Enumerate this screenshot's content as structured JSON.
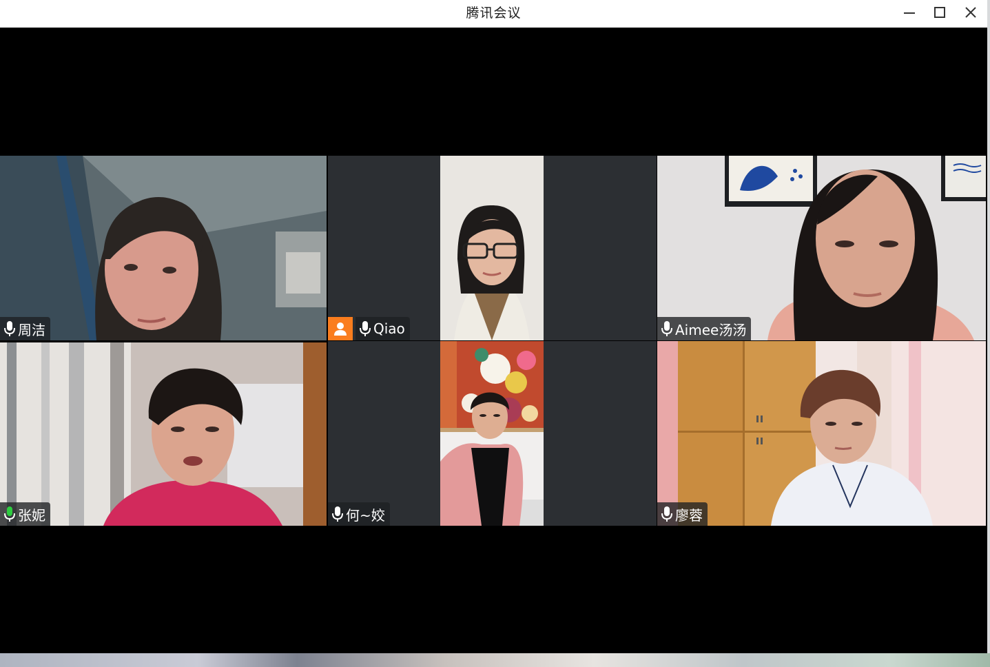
{
  "window": {
    "title": "腾讯会议",
    "controls": [
      "minimize",
      "maximize",
      "close"
    ]
  },
  "participants": [
    {
      "name": "周洁",
      "mic": "muted-white",
      "speaking": false,
      "video_on": true
    },
    {
      "name": "Qiao",
      "mic": "muted-white",
      "speaking": false,
      "video_on": true,
      "badge": "host-avatar-icon"
    },
    {
      "name": "Aimee汤汤",
      "mic": "muted-white",
      "speaking": false,
      "video_on": true
    },
    {
      "name": "张妮",
      "mic": "active-green",
      "speaking": true,
      "video_on": true
    },
    {
      "name": "何~姣",
      "mic": "muted-white",
      "speaking": false,
      "video_on": true
    },
    {
      "name": "廖蓉",
      "mic": "muted-white",
      "speaking": false,
      "video_on": true
    }
  ],
  "colors": {
    "speaking_border": "#1ec85a",
    "mic_active": "#2ecc40",
    "host_badge": "#fa7d1e",
    "tile_bg": "#2c2f33"
  }
}
